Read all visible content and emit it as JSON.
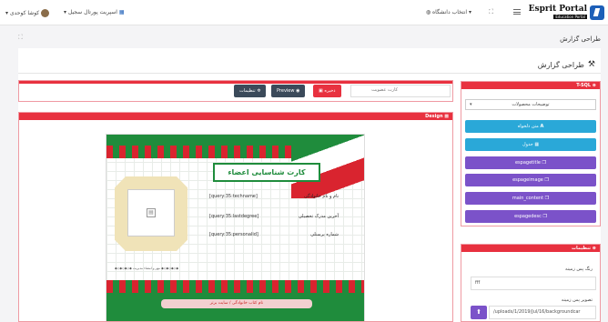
{
  "header": {
    "brand_name": "Esprit Portal",
    "brand_sub": "Education Portal",
    "select_university": "انتخاب دانشگاه",
    "tenant": "اسپریت پورتال سجیل",
    "user": "کوشا کوحدی"
  },
  "page": {
    "title": "طراحی گزارش",
    "subtitle": "طراحی گزارش"
  },
  "toolbar": {
    "card_label": "کارت عضویت",
    "save": "ذخیره",
    "preview": "Preview",
    "settings": "تنظیمات"
  },
  "design": {
    "heading": "Design",
    "card_title": "کارت شناسایی اعضاء",
    "fields": [
      {
        "label": "نام و نام خانوادگی",
        "value": "[query:35:techname]"
      },
      {
        "label": "آخرین مدرک تحصیلی",
        "value": "[query:35:lastdegree]"
      },
      {
        "label": "شماره پرسنلی",
        "value": "[query:35:personalid]"
      }
    ],
    "footer_text": "مهر و امضاء مدیریت",
    "bottom_caption": "نام کتاب خانوادگی / سایت برتر"
  },
  "tsql": {
    "heading": "T-SQL",
    "select_value": "توضیحات محصولات",
    "buttons": [
      {
        "label": "متن دلخواه",
        "color": "#2aa8d8"
      },
      {
        "label": "جدول",
        "color": "#2aa8d8"
      },
      {
        "label": "espagetitle",
        "color": "#7b52c9"
      },
      {
        "label": "espageimage",
        "color": "#7b52c9"
      },
      {
        "label": "main_content",
        "color": "#7b52c9"
      },
      {
        "label": "espagedesc",
        "color": "#7b52c9"
      }
    ]
  },
  "settings": {
    "heading": "تنظیمات",
    "bg_color_label": "رنگ پس زمینه",
    "bg_color_value": "fff",
    "bg_image_label": "تصویر پس زمینه",
    "bg_image_value": "/uploads/1/2019/Jul/16/backgroundcar"
  },
  "colors": {
    "accent_red": "#e8313f",
    "green": "#1f8c3c",
    "teal": "#2aa8d8",
    "purple": "#7b52c9",
    "dark_button": "#3b4a5a"
  }
}
